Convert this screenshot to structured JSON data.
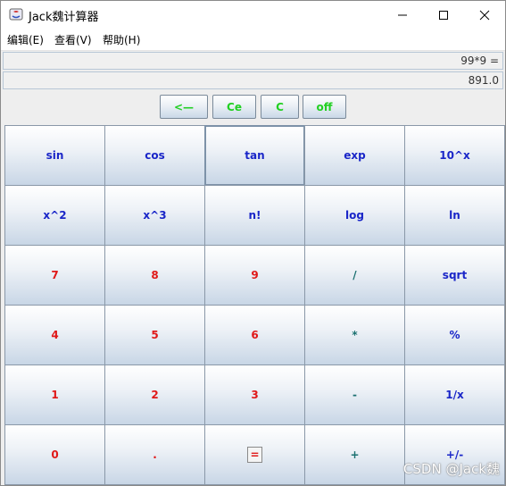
{
  "window": {
    "title": "Jack魏计算器"
  },
  "menu": [
    "编辑(E)",
    "查看(V)",
    "帮助(H)"
  ],
  "display": {
    "expression": "99*9 =",
    "result": "891.0"
  },
  "controls": [
    "<—",
    "Ce",
    "C",
    "off"
  ],
  "keys": [
    [
      "sin",
      "cos",
      "tan",
      "exp",
      "10^x"
    ],
    [
      "x^2",
      "x^3",
      "n!",
      "log",
      "ln"
    ],
    [
      "7",
      "8",
      "9",
      "/",
      "sqrt"
    ],
    [
      "4",
      "5",
      "6",
      "*",
      "%"
    ],
    [
      "1",
      "2",
      "3",
      "-",
      "1/x"
    ],
    [
      "0",
      ".",
      "=",
      "+",
      "+/-"
    ]
  ],
  "watermark": "CSDN @Jack魏",
  "colors": {
    "function_key": "#1a26c8",
    "digit_key": "#e01818",
    "operator_key": "#1a7070",
    "control_key": "#22d022"
  }
}
